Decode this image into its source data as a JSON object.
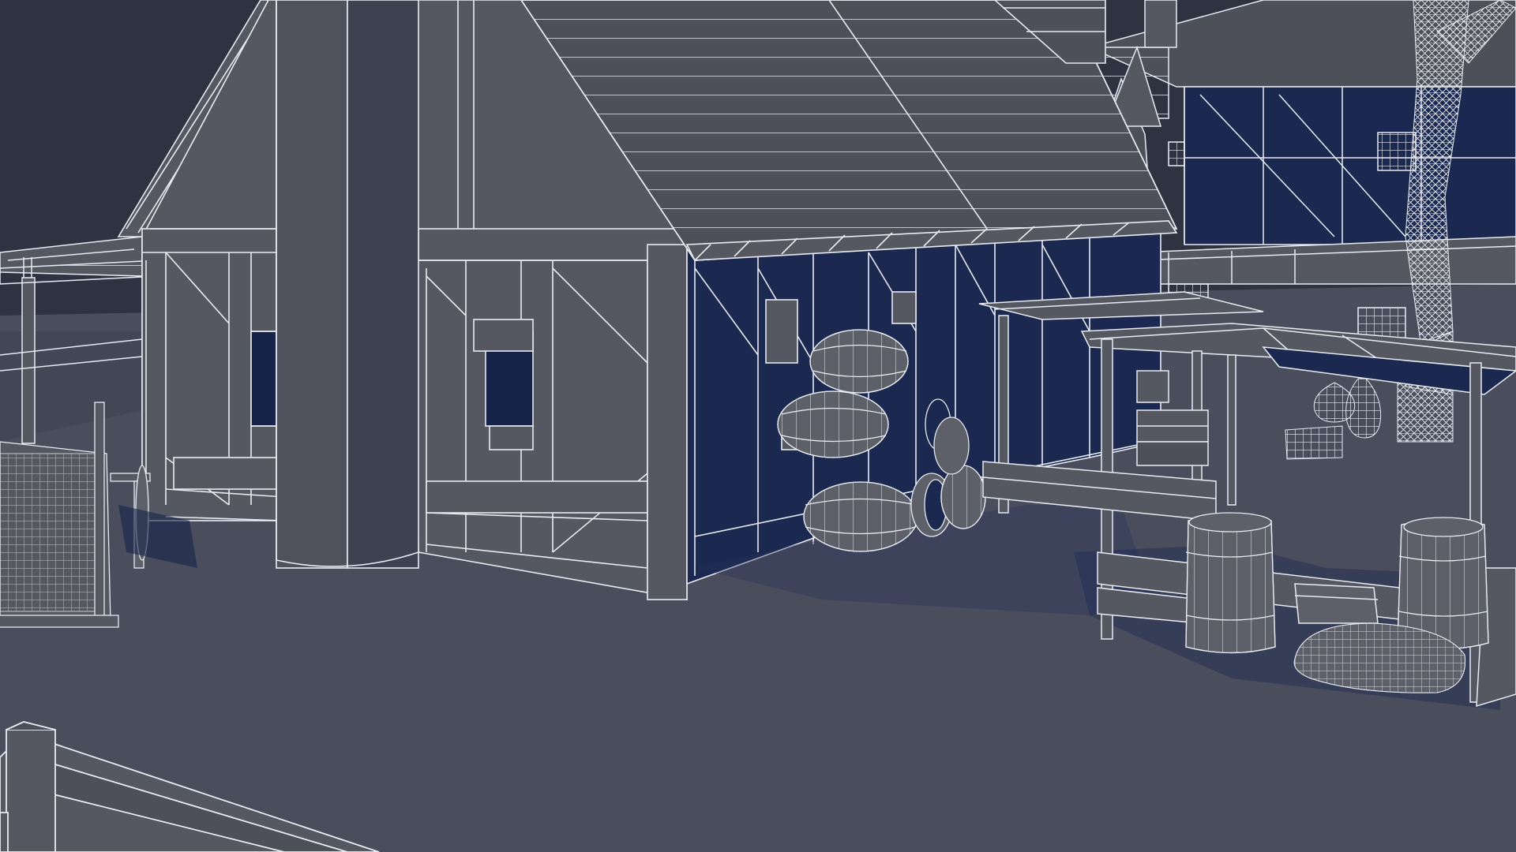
{
  "viewport": {
    "view_mode": "shaded-wireframe",
    "colors": {
      "sky": "#2f3341",
      "ground": "#4a4d5c",
      "ground_far": "#434655",
      "wall": "#555860",
      "wall_dark": "#474a55",
      "shadow": "#16244a",
      "roof": "#4d5058",
      "wire": "#e8ebf2",
      "wire_dim": "#b9bdca",
      "prop": "#5d6068"
    }
  },
  "scene": {
    "objects": [
      {
        "name": "main-house",
        "kind": "half-timbered-house"
      },
      {
        "name": "chimney",
        "kind": "stone-chimney"
      },
      {
        "name": "barrel-stack",
        "kind": "barrels",
        "count": 6
      },
      {
        "name": "market-stall",
        "kind": "stall"
      },
      {
        "name": "stall-barrels",
        "kind": "barrels",
        "count": 2
      },
      {
        "name": "pottery",
        "kind": "jars",
        "count": 3
      },
      {
        "name": "grain-sack",
        "kind": "sack"
      },
      {
        "name": "wooden-cart",
        "kind": "cart"
      },
      {
        "name": "foreground-fence",
        "kind": "fence"
      },
      {
        "name": "background-buildings",
        "kind": "houses"
      },
      {
        "name": "tree",
        "kind": "tree"
      },
      {
        "name": "left-shed",
        "kind": "shed"
      }
    ]
  }
}
